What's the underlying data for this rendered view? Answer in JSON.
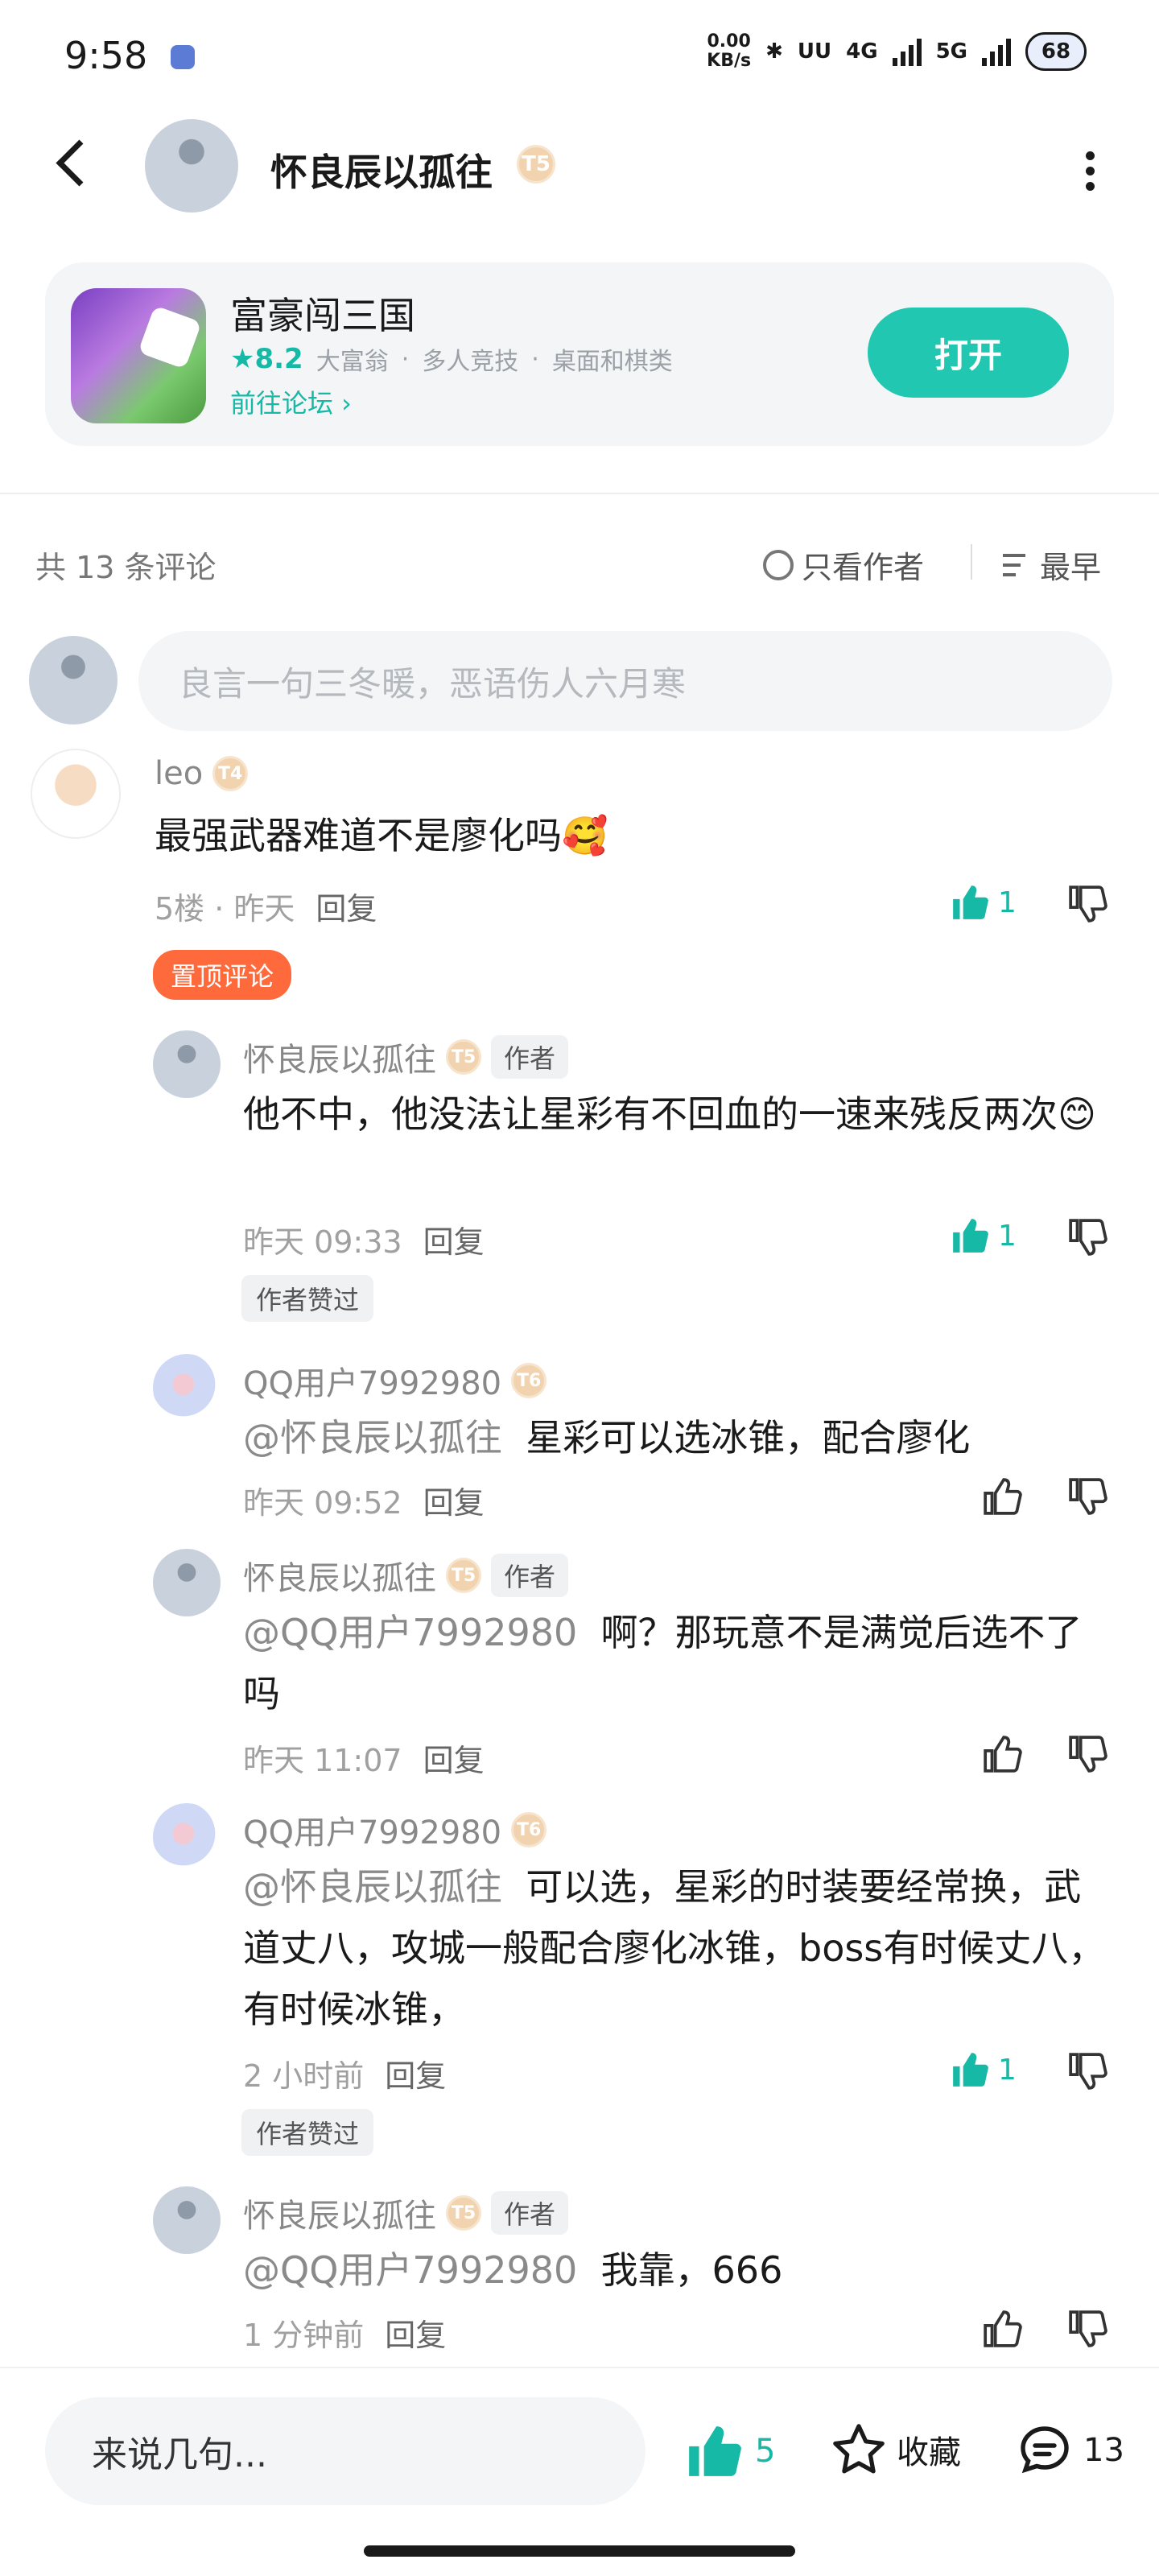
{
  "status": {
    "time": "9:58",
    "netspeed_top": "0.00",
    "netspeed_bottom": "KB/s",
    "net1": "4G",
    "net2": "5G",
    "battery": "68"
  },
  "header": {
    "title": "怀良辰以孤往",
    "badge": "T5"
  },
  "game": {
    "title": "富豪闯三国",
    "rating": "★8.2",
    "tags": [
      "大富翁",
      "·",
      "多人竞技",
      "·",
      "桌面和棋类"
    ],
    "forum_link": "前往论坛 ›",
    "open_label": "打开"
  },
  "comments_bar": {
    "count": "共 13 条评论",
    "only_author": "只看作者",
    "sort": "最早"
  },
  "composer": {
    "placeholder": "良言一句三冬暖，恶语伤人六月寒"
  },
  "comments": [
    {
      "name": "leo",
      "badge": "T4",
      "text": "最强武器难道不是廖化吗🥰",
      "meta": "5楼 · 昨天",
      "reply": "回复",
      "likes": "1",
      "pin": "置顶评论"
    },
    {
      "name": "怀良辰以孤往",
      "badge": "T5",
      "author_tag": "作者",
      "text": "他不中，他没法让星彩有不回血的一速来残反两次😊",
      "meta": "昨天 09:33",
      "reply": "回复",
      "likes": "1",
      "liked_tag": "作者赞过"
    },
    {
      "name": "QQ用户7992980",
      "badge": "T6",
      "at": "@怀良辰以孤往",
      "text": "星彩可以选冰锥，配合廖化",
      "meta": "昨天 09:52",
      "reply": "回复"
    },
    {
      "name": "怀良辰以孤往",
      "badge": "T5",
      "author_tag": "作者",
      "at": "@QQ用户7992980",
      "text": "啊？那玩意不是满觉后选不了吗",
      "meta": "昨天 11:07",
      "reply": "回复"
    },
    {
      "name": "QQ用户7992980",
      "badge": "T6",
      "at": "@怀良辰以孤往",
      "text": "可以选，星彩的时装要经常换，武道丈八，攻城一般配合廖化冰锥，boss有时候丈八，有时候冰锥，",
      "meta": "2 小时前",
      "reply": "回复",
      "likes": "1",
      "liked_tag": "作者赞过"
    },
    {
      "name": "怀良辰以孤往",
      "badge": "T5",
      "author_tag": "作者",
      "at": "@QQ用户7992980",
      "text": "我靠，666",
      "meta": "1 分钟前",
      "reply": "回复"
    }
  ],
  "bottom": {
    "input_placeholder": "来说几句...",
    "likes": "5",
    "favorite": "收藏",
    "comment_count": "13"
  },
  "colors": {
    "accent": "#21c7b0",
    "pin": "#ff6a3c"
  }
}
